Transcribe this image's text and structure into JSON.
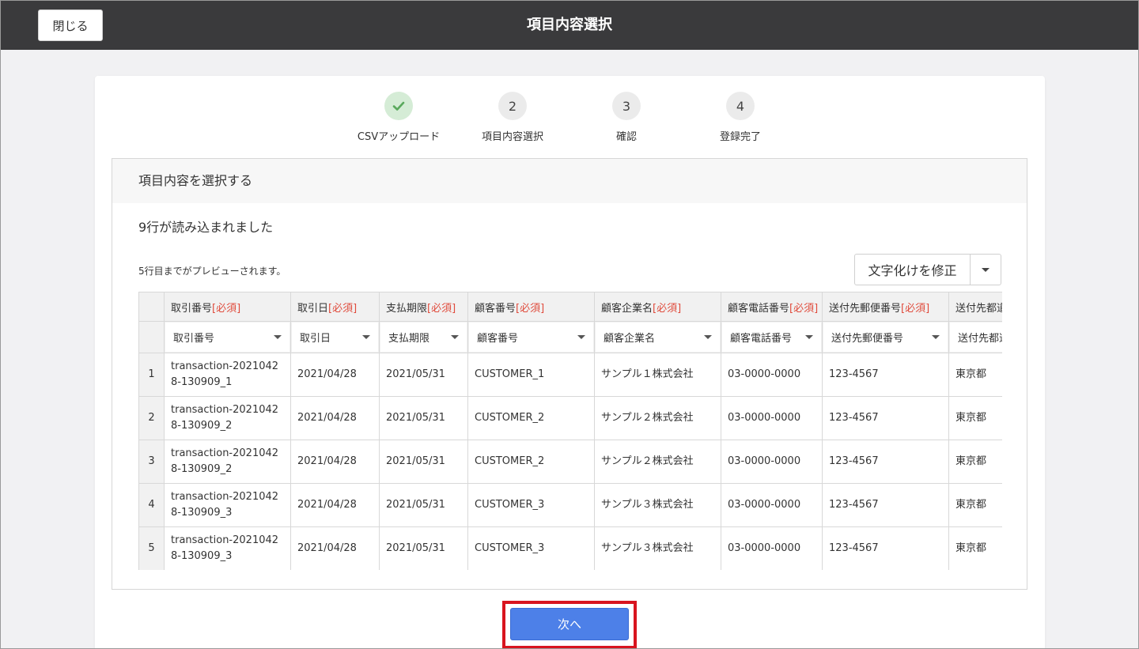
{
  "topbar": {
    "close_label": "閉じる",
    "title": "項目内容選択"
  },
  "steps": [
    {
      "label": "CSVアップロード",
      "number": "",
      "done": true
    },
    {
      "label": "項目内容選択",
      "number": "2"
    },
    {
      "label": "確認",
      "number": "3"
    },
    {
      "label": "登録完了",
      "number": "4"
    }
  ],
  "panel": {
    "title": "項目内容を選択する",
    "rows_loaded": "9行が読み込まれました",
    "preview_note": "5行目までがプレビューされます。",
    "fix_encoding_label": "文字化けを修正"
  },
  "table": {
    "required_mark": "[必須]",
    "columns": [
      {
        "name": "取引番号",
        "required": true,
        "select": "取引番号"
      },
      {
        "name": "取引日",
        "required": true,
        "select": "取引日"
      },
      {
        "name": "支払期限",
        "required": true,
        "select": "支払期限"
      },
      {
        "name": "顧客番号",
        "required": true,
        "select": "顧客番号"
      },
      {
        "name": "顧客企業名",
        "required": true,
        "select": "顧客企業名"
      },
      {
        "name": "顧客電話番号",
        "required": true,
        "select": "顧客電話番号"
      },
      {
        "name": "送付先郵便番号",
        "required": true,
        "select": "送付先郵便番号"
      },
      {
        "name": "送付先都道",
        "required": false,
        "select": "送付先都道"
      }
    ],
    "rows": [
      {
        "num": "1",
        "cells": [
          "transaction-20210428-130909_1",
          "2021/04/28",
          "2021/05/31",
          "CUSTOMER_1",
          "サンプル１株式会社",
          "03-0000-0000",
          "123-4567",
          "東京都"
        ]
      },
      {
        "num": "2",
        "cells": [
          "transaction-20210428-130909_2",
          "2021/04/28",
          "2021/05/31",
          "CUSTOMER_2",
          "サンプル２株式会社",
          "03-0000-0000",
          "123-4567",
          "東京都"
        ]
      },
      {
        "num": "3",
        "cells": [
          "transaction-20210428-130909_2",
          "2021/04/28",
          "2021/05/31",
          "CUSTOMER_2",
          "サンプル２株式会社",
          "03-0000-0000",
          "123-4567",
          "東京都"
        ]
      },
      {
        "num": "4",
        "cells": [
          "transaction-20210428-130909_3",
          "2021/04/28",
          "2021/05/31",
          "CUSTOMER_3",
          "サンプル３株式会社",
          "03-0000-0000",
          "123-4567",
          "東京都"
        ]
      },
      {
        "num": "5",
        "cells": [
          "transaction-20210428-130909_3",
          "2021/04/28",
          "2021/05/31",
          "CUSTOMER_3",
          "サンプル３株式会社",
          "03-0000-0000",
          "123-4567",
          "東京都"
        ]
      }
    ]
  },
  "footer": {
    "next_label": "次へ"
  },
  "colors": {
    "topbar": "#3a3a3c",
    "primary": "#4d80e8",
    "required": "#e04b3c",
    "highlight": "#d8141f",
    "step_done": "#d5ecd6",
    "check": "#5aa95d"
  }
}
